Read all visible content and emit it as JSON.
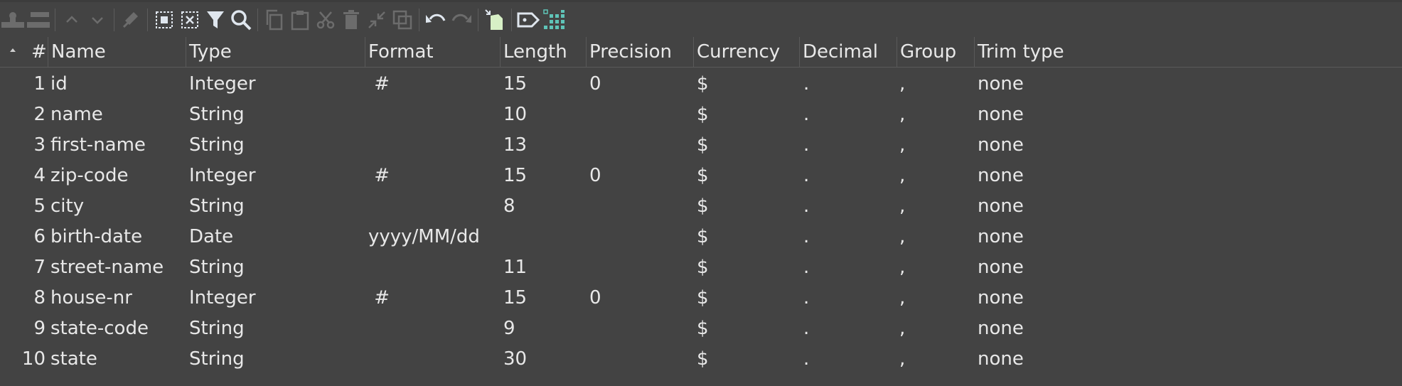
{
  "toolbar": {
    "buttons": [
      {
        "icon": "insert-row-icon",
        "enabled": false
      },
      {
        "icon": "delete-row-icon",
        "enabled": false
      },
      {
        "sep": true
      },
      {
        "icon": "move-up-icon",
        "enabled": false
      },
      {
        "icon": "move-down-icon",
        "enabled": false
      },
      {
        "sep": true
      },
      {
        "icon": "clear-icon",
        "enabled": false
      },
      {
        "sep": true
      },
      {
        "icon": "select-all-icon",
        "enabled": true
      },
      {
        "icon": "deselect-icon",
        "enabled": true
      },
      {
        "icon": "filter-icon",
        "enabled": true
      },
      {
        "icon": "search-icon",
        "enabled": true
      },
      {
        "sep": true
      },
      {
        "icon": "copy-icon",
        "enabled": false
      },
      {
        "icon": "paste-icon",
        "enabled": false
      },
      {
        "icon": "cut-icon",
        "enabled": false
      },
      {
        "icon": "trash-icon",
        "enabled": false
      },
      {
        "icon": "collapse-icon",
        "enabled": false
      },
      {
        "icon": "duplicate-icon",
        "enabled": false
      },
      {
        "sep": true
      },
      {
        "icon": "undo-icon",
        "enabled": true
      },
      {
        "icon": "redo-icon",
        "enabled": false
      },
      {
        "sep": true
      },
      {
        "icon": "get-fields-icon",
        "enabled": true
      },
      {
        "sep": true
      },
      {
        "icon": "tag-icon",
        "enabled": true
      },
      {
        "icon": "grid-icon",
        "enabled": true
      }
    ]
  },
  "table": {
    "headers": {
      "num": "#",
      "name": "Name",
      "type": "Type",
      "format": "Format",
      "length": "Length",
      "precision": "Precision",
      "currency": "Currency",
      "decimal": "Decimal",
      "group": "Group",
      "trim": "Trim type"
    },
    "rows": [
      {
        "num": "1",
        "name": "id",
        "type": "Integer",
        "format": " #",
        "length": "15",
        "precision": "0",
        "currency": "$",
        "decimal": ".",
        "group": ",",
        "trim": "none"
      },
      {
        "num": "2",
        "name": "name",
        "type": "String",
        "format": "",
        "length": "10",
        "precision": "",
        "currency": "$",
        "decimal": ".",
        "group": ",",
        "trim": "none"
      },
      {
        "num": "3",
        "name": "first-name",
        "type": "String",
        "format": "",
        "length": "13",
        "precision": "",
        "currency": "$",
        "decimal": ".",
        "group": ",",
        "trim": "none"
      },
      {
        "num": "4",
        "name": "zip-code",
        "type": "Integer",
        "format": " #",
        "length": "15",
        "precision": "0",
        "currency": "$",
        "decimal": ".",
        "group": ",",
        "trim": "none"
      },
      {
        "num": "5",
        "name": "city",
        "type": "String",
        "format": "",
        "length": "8",
        "precision": "",
        "currency": "$",
        "decimal": ".",
        "group": ",",
        "trim": "none"
      },
      {
        "num": "6",
        "name": "birth-date",
        "type": "Date",
        "format": "yyyy/MM/dd",
        "length": "",
        "precision": "",
        "currency": "$",
        "decimal": ".",
        "group": ",",
        "trim": "none"
      },
      {
        "num": "7",
        "name": "street-name",
        "type": "String",
        "format": "",
        "length": "11",
        "precision": "",
        "currency": "$",
        "decimal": ".",
        "group": ",",
        "trim": "none"
      },
      {
        "num": "8",
        "name": "house-nr",
        "type": "Integer",
        "format": " #",
        "length": "15",
        "precision": "0",
        "currency": "$",
        "decimal": ".",
        "group": ",",
        "trim": "none"
      },
      {
        "num": "9",
        "name": "state-code",
        "type": "String",
        "format": "",
        "length": "9",
        "precision": "",
        "currency": "$",
        "decimal": ".",
        "group": ",",
        "trim": "none"
      },
      {
        "num": "10",
        "name": "state",
        "type": "String",
        "format": "",
        "length": "30",
        "precision": "",
        "currency": "$",
        "decimal": ".",
        "group": ",",
        "trim": "none"
      }
    ]
  },
  "colors": {
    "background": "#434343",
    "text": "#e8e8e8",
    "icon_enabled": "#dfe6ee",
    "icon_disabled": "#6c6c6c",
    "accent_teal": "#5fc4b8"
  }
}
